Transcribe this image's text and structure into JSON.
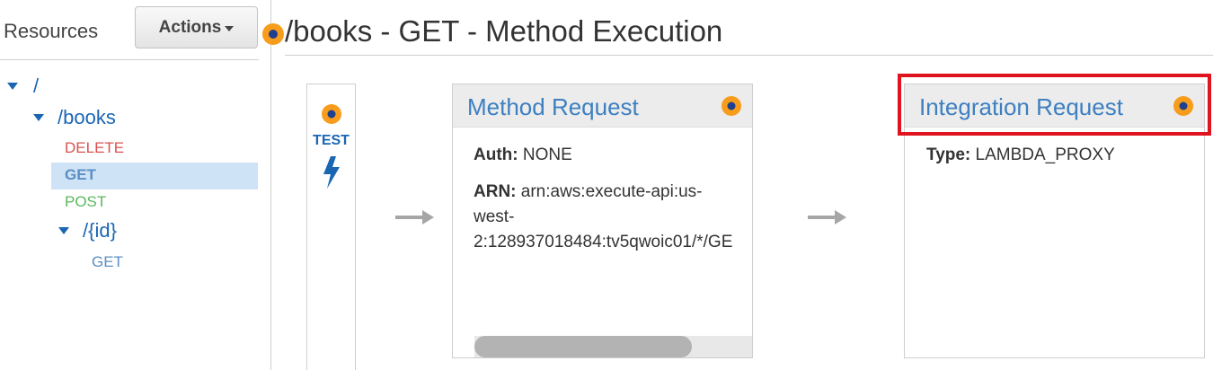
{
  "sidebar": {
    "title": "Resources",
    "actions_label": "Actions",
    "tree": {
      "root": "/",
      "books": "/books",
      "methods": [
        "DELETE",
        "GET",
        "POST"
      ],
      "id_path": "/{id}",
      "id_method": "GET"
    }
  },
  "main": {
    "title": "/books - GET - Method Execution",
    "test_label": "TEST"
  },
  "method_request": {
    "title": "Method Request",
    "auth_label": "Auth:",
    "auth_value": "NONE",
    "arn_label": "ARN:",
    "arn_line1": "arn:aws:execute-api:us-",
    "arn_line2": "west-",
    "arn_line3": "2:128937018484:tv5qwoic01/*/GE",
    "scroll_fraction": 0.78
  },
  "integration_request": {
    "title": "Integration Request",
    "type_label": "Type:",
    "type_value": "LAMBDA_PROXY"
  },
  "colors": {
    "accent": "#1a66b3",
    "link": "#3d7fc1",
    "delete": "#d9534f",
    "post": "#5cb85c",
    "get": "#5a8fc4",
    "orange": "#f89c1c",
    "highlight": "#e0141e"
  },
  "icons": [
    "orange-circle-icon",
    "caret-down-icon",
    "lightning-bolt-icon",
    "arrow-right-icon"
  ]
}
